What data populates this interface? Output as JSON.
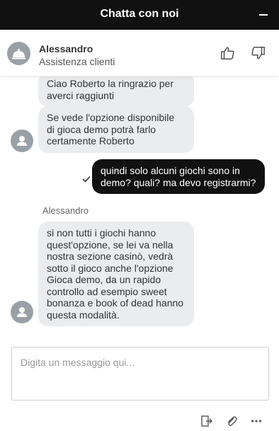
{
  "window": {
    "title": "Chatta con noi"
  },
  "agent": {
    "name": "Alessandro",
    "role": "Assistenza clienti"
  },
  "messages": [
    {
      "direction": "in",
      "text": "Ciao Roberto la ringrazio per\naverci raggiunti"
    },
    {
      "direction": "in",
      "text": "Se vede l'opzione disponibile\ndi gioca demo potrà farlo\ncertamente Roberto"
    },
    {
      "direction": "out",
      "text": "quindi solo alcuni giochi sono in\ndemo? quali? ma devo registrarmi?"
    },
    {
      "direction": "in",
      "sender": "Alessandro",
      "text": "si non tutti i giochi hanno\nquest'opzione, se lei va nella\nnostra sezione casinò, vedrà\nsotto il gioco anche l'opzione\nGioca demo, da un rapido\ncontrollo ad esempio sweet\nbonanza e book of dead hanno\nquesta modalità."
    }
  ],
  "composer": {
    "placeholder": "Digita un messaggio qui..."
  },
  "icons": {
    "minimize": "minimize-icon",
    "thumbs_up": "thumbs-up-icon",
    "thumbs_down": "thumbs-down-icon",
    "exit": "exit-chat-icon",
    "attach": "paperclip-icon",
    "more": "more-options-icon"
  },
  "colors": {
    "header": "#111111",
    "bubble_in": "#ebecee",
    "bubble_out": "#111111",
    "avatar": "#9aa0a7"
  }
}
